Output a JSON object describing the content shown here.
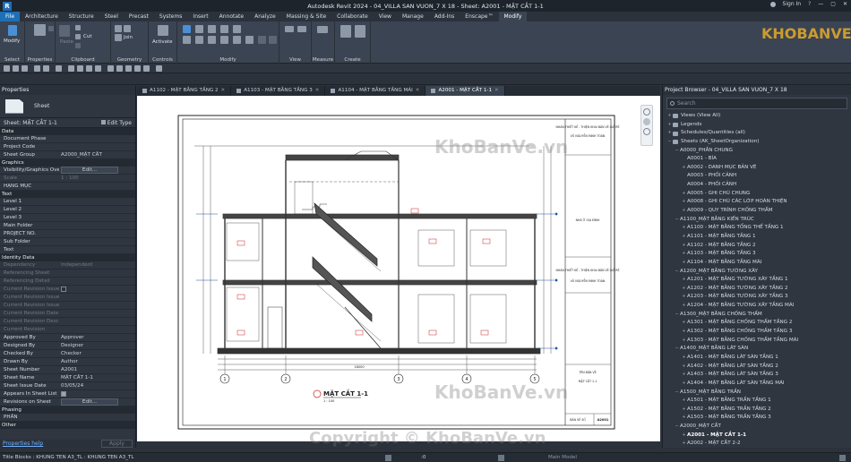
{
  "app": {
    "title": "Autodesk Revit 2024 - 04_VILLA SAN VUON_7 X 18 - Sheet: A2001 - MẶT CẮT 1-1",
    "logo_letter": "R",
    "sign_in": "Sign In"
  },
  "ribbon_tabs": [
    "File",
    "Architecture",
    "Structure",
    "Steel",
    "Precast",
    "Systems",
    "Insert",
    "Annotate",
    "Analyze",
    "Massing & Site",
    "Collaborate",
    "View",
    "Manage",
    "Add-Ins",
    "Enscape™",
    "Modify"
  ],
  "ribbon": {
    "groups": [
      "Select",
      "Properties",
      "Clipboard",
      "Geometry",
      "Controls",
      "Modify",
      "View",
      "Measure",
      "Create"
    ],
    "modify_label": "Modify",
    "properties_label": "Properties",
    "paste_label": "Paste",
    "cut_label": "Cut",
    "join_label": "Join",
    "activate_label": "Activate"
  },
  "properties": {
    "title": "Properties",
    "type_name": "Sheet",
    "instance_selector": "Sheet: MẶT CẮT 1-1",
    "edit_type": "Edit Type",
    "sections": [
      {
        "name": "Data",
        "rows": [
          {
            "k": "Document Phase",
            "v": ""
          },
          {
            "k": "Project Code",
            "v": ""
          },
          {
            "k": "Sheet Group",
            "v": "A2000_MẶT CẮT"
          }
        ]
      },
      {
        "name": "Graphics",
        "rows": [
          {
            "k": "Visibility/Graphics Ove...",
            "v": "Edit...",
            "button": true
          },
          {
            "k": "Scale",
            "v": "1 : 100",
            "dim": true
          },
          {
            "k": "HẠNG MỤC",
            "v": ""
          }
        ]
      },
      {
        "name": "Text",
        "rows": [
          {
            "k": "Level 1",
            "v": ""
          },
          {
            "k": "Level 2",
            "v": ""
          },
          {
            "k": "Level 3",
            "v": ""
          },
          {
            "k": "Main Folder",
            "v": ""
          },
          {
            "k": "PROJECT NO.",
            "v": ""
          },
          {
            "k": "Sub Folder",
            "v": ""
          },
          {
            "k": "Text",
            "v": ""
          }
        ]
      },
      {
        "name": "Identity Data",
        "rows": [
          {
            "k": "Dependency",
            "v": "Independent",
            "dim": true
          },
          {
            "k": "Referencing Sheet",
            "v": "",
            "dim": true
          },
          {
            "k": "Referencing Detail",
            "v": "",
            "dim": true
          },
          {
            "k": "Current Revision Issued",
            "v": "",
            "dim": true,
            "check": true
          },
          {
            "k": "Current Revision Issue...",
            "v": "",
            "dim": true
          },
          {
            "k": "Current Revision Issue...",
            "v": "",
            "dim": true
          },
          {
            "k": "Current Revision Date",
            "v": "",
            "dim": true
          },
          {
            "k": "Current Revision Descr...",
            "v": "",
            "dim": true
          },
          {
            "k": "Current Revision",
            "v": "",
            "dim": true
          },
          {
            "k": "Approved By",
            "v": "Approver"
          },
          {
            "k": "Designed By",
            "v": "Designer"
          },
          {
            "k": "Checked By",
            "v": "Checker"
          },
          {
            "k": "Drawn By",
            "v": "Author"
          },
          {
            "k": "Sheet Number",
            "v": "A2001"
          },
          {
            "k": "Sheet Name",
            "v": "MẶT CẮT 1-1"
          },
          {
            "k": "Sheet Issue Date",
            "v": "03/05/24"
          },
          {
            "k": "Appears In Sheet List",
            "v": "",
            "check": true,
            "checked": true
          },
          {
            "k": "Revisions on Sheet",
            "v": "Edit...",
            "button": true
          }
        ]
      },
      {
        "name": "Phasing",
        "rows": [
          {
            "k": "PHẦN",
            "v": ""
          }
        ]
      },
      {
        "name": "Other",
        "rows": []
      }
    ],
    "help_link": "Properties help",
    "apply": "Apply"
  },
  "view_tabs": [
    {
      "label": "A1102 - MẶT BẰNG TẦNG 2",
      "active": false
    },
    {
      "label": "A1103 - MẶT BẰNG TẦNG 3",
      "active": false
    },
    {
      "label": "A1104 - MẶT BẰNG TẦNG MÁI",
      "active": false
    },
    {
      "label": "A2001 - MẶT CẮT 1-1",
      "active": true
    }
  ],
  "drawing": {
    "view_title": "MẶT CẮT 1-1",
    "view_scale": "1 : 100",
    "grid_labels": [
      "1",
      "2",
      "3",
      "4",
      "5"
    ],
    "dim_total": "18000",
    "tb_company": "NHÀN THIẾT KẾ - THIỆN KHAI BẢN VẼ GIẢ RẺ",
    "tb_name": "VÕ NGUYỄN MINH TOÀN",
    "tb_owner": "NHÀ Ở GIA ĐÌNH",
    "tb_sheet_name_label": "TÊN BẢN VẼ",
    "tb_sheet_name": "MẶT CẮT 1-1",
    "tb_sheet_no_label": "BẢN VẼ SỐ",
    "tb_sheet_no": "A2001"
  },
  "browser": {
    "title": "Project Browser - 04_VILLA SAN VUON_7 X 18",
    "search_placeholder": "Search",
    "items": [
      {
        "level": 0,
        "exp": "+",
        "icon": true,
        "label": "Views (View All)"
      },
      {
        "level": 0,
        "exp": "+",
        "icon": true,
        "label": "Legends"
      },
      {
        "level": 0,
        "exp": "+",
        "icon": true,
        "label": "Schedules/Quantities (all)"
      },
      {
        "level": 0,
        "exp": "−",
        "icon": true,
        "label": "Sheets (AK_SheetOrganization)"
      },
      {
        "level": 1,
        "exp": "−",
        "label": "A0000_PHẦN CHUNG"
      },
      {
        "level": 2,
        "exp": "",
        "label": "A0001 - BÌA"
      },
      {
        "level": 2,
        "exp": "+",
        "label": "A0002 - DANH MỤC BẢN VẼ"
      },
      {
        "level": 2,
        "exp": "",
        "label": "A0003 - PHỐI CẢNH"
      },
      {
        "level": 2,
        "exp": "",
        "label": "A0004 - PHỐI CẢNH"
      },
      {
        "level": 2,
        "exp": "+",
        "label": "A0005 - GHI CHÚ CHUNG"
      },
      {
        "level": 2,
        "exp": "+",
        "label": "A0008 - GHI CHÚ CÁC LỚP HOÀN THIỆN"
      },
      {
        "level": 2,
        "exp": "+",
        "label": "A0009 - QUY TRÌNH CHỐNG THẤM"
      },
      {
        "level": 1,
        "exp": "−",
        "label": "A1100_MẶT BẰNG KIẾN TRÚC"
      },
      {
        "level": 2,
        "exp": "+",
        "label": "A1100 - MẶT BẰNG TỔNG THỂ TẦNG 1"
      },
      {
        "level": 2,
        "exp": "+",
        "label": "A1101 - MẶT BẰNG TẦNG 1"
      },
      {
        "level": 2,
        "exp": "+",
        "label": "A1102 - MẶT BẰNG TẦNG 2"
      },
      {
        "level": 2,
        "exp": "+",
        "label": "A1103 - MẶT BẰNG TẦNG 3"
      },
      {
        "level": 2,
        "exp": "+",
        "label": "A1104 - MẶT BẰNG TẦNG MÁI"
      },
      {
        "level": 1,
        "exp": "−",
        "label": "A1200_MẶT BẰNG TƯỜNG XÂY"
      },
      {
        "level": 2,
        "exp": "+",
        "label": "A1201 - MẶT BẰNG TƯỜNG XÂY TẦNG 1"
      },
      {
        "level": 2,
        "exp": "+",
        "label": "A1202 - MẶT BẰNG TƯỜNG XÂY TẦNG 2"
      },
      {
        "level": 2,
        "exp": "+",
        "label": "A1203 - MẶT BẰNG TƯỜNG XÂY TẦNG 3"
      },
      {
        "level": 2,
        "exp": "+",
        "label": "A1204 - MẶT BẰNG TƯỜNG XÂY TẦNG MÁI"
      },
      {
        "level": 1,
        "exp": "−",
        "label": "A1300_MẶT BẰNG CHỐNG THẤM"
      },
      {
        "level": 2,
        "exp": "+",
        "label": "A1301 - MẶT BẰNG CHỐNG THẤM TẦNG 2"
      },
      {
        "level": 2,
        "exp": "+",
        "label": "A1302 - MẶT BẰNG CHỐNG THẤM TẦNG 3"
      },
      {
        "level": 2,
        "exp": "+",
        "label": "A1303 - MẶT BẰNG CHỐNG THẤM TẦNG MÁI"
      },
      {
        "level": 1,
        "exp": "−",
        "label": "A1400_MẶT BẰNG LÁT SÀN"
      },
      {
        "level": 2,
        "exp": "+",
        "label": "A1401 - MẶT BẰNG LÁT SÀN TẦNG 1"
      },
      {
        "level": 2,
        "exp": "+",
        "label": "A1402 - MẶT BẰNG LÁT SÀN TẦNG 2"
      },
      {
        "level": 2,
        "exp": "+",
        "label": "A1403 - MẶT BẰNG LÁT SÀN TẦNG 3"
      },
      {
        "level": 2,
        "exp": "+",
        "label": "A1404 - MẶT BẰNG LÁT SÀN TẦNG MÁI"
      },
      {
        "level": 1,
        "exp": "−",
        "label": "A1500_MẶT BẰNG TRẦN"
      },
      {
        "level": 2,
        "exp": "+",
        "label": "A1501 - MẶT BẰNG TRẦN TẦNG 1"
      },
      {
        "level": 2,
        "exp": "+",
        "label": "A1502 - MẶT BẰNG TRẦN TẦNG 2"
      },
      {
        "level": 2,
        "exp": "+",
        "label": "A1503 - MẶT BẰNG TRẦN TẦNG 3"
      },
      {
        "level": 1,
        "exp": "−",
        "label": "A2000_MẶT CẮT"
      },
      {
        "level": 2,
        "exp": "+",
        "label": "A2001 - MẶT CẮT 1-1",
        "selected": true
      },
      {
        "level": 2,
        "exp": "+",
        "label": "A2002 - MẶT CẮT 2-2"
      }
    ]
  },
  "status": {
    "left": "Title Blocks : KHUNG TEN A3_TL : KHUNG TEN A3_TL",
    "model": "Main Model",
    "zoom": ":0"
  },
  "watermarks": {
    "brand": "KHOBANVE",
    "mid": "KhoBanVe.vn",
    "copyright": "Copyright © KhoBanVe.vn"
  },
  "colors": {
    "accent": "#1f6fb7",
    "panel": "#2f3640",
    "ribbon": "#3b4452"
  }
}
